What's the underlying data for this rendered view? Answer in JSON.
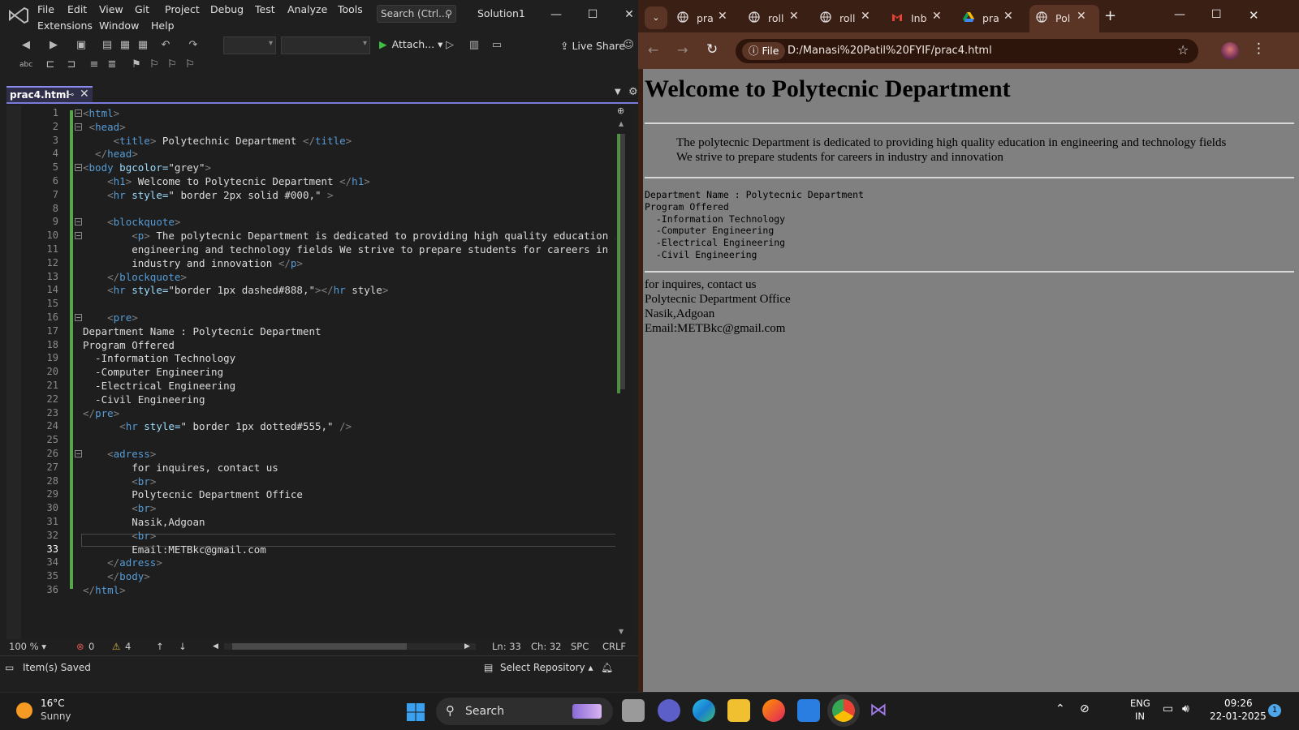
{
  "vs": {
    "menu": [
      "File",
      "Edit",
      "View",
      "Git",
      "Project",
      "Debug",
      "Test",
      "Analyze",
      "Tools",
      "Extensions",
      "Window",
      "Help"
    ],
    "search_placeholder": "Search (Ctrl...",
    "solution": "Solution1",
    "attach_label": "Attach...",
    "liveshare_label": "Live Share",
    "tab_label": "prac4.html",
    "code_lines": [
      "<html>",
      " <head>",
      "     <title> Polytechnic Department </title>",
      "  </head>",
      "<body bgcolor=\"grey\">",
      "    <h1> Welcome to Polytecnic Department </h1>",
      "    <hr style=\" border 2px solid #000,\" >",
      "",
      "    <blockquote>",
      "        <p> The polytecnic Department is dedicated to providing high quality education i",
      "        engineering and technology fields We strive to prepare students for careers in",
      "        industry and innovation </p>",
      "    </blockquote>",
      "    <hr style=\"border 1px dashed#888,\"></hr style>",
      "",
      "    <pre>",
      "Department Name : Polytecnic Department",
      "Program Offered",
      "  -Information Technology",
      "  -Computer Engineering",
      "  -Electrical Engineering",
      "  -Civil Engineering",
      "</pre>",
      "      <hr style=\" border 1px dotted#555,\" />",
      "",
      "    <adress>",
      "        for inquires, contact us",
      "        <br>",
      "        Polytecnic Department Office",
      "        <br>",
      "        Nasik,Adgoan",
      "        <br>",
      "        Email:METBkc@gmail.com",
      "    </adress>",
      "    </body>",
      "</html>"
    ],
    "current_line": 33,
    "zoom": "100 %",
    "errors": "0",
    "warnings": "4",
    "ln": "Ln: 33",
    "ch": "Ch: 32",
    "spc": "SPC",
    "crlf": "CRLF",
    "status_saved": "Item(s) Saved",
    "select_repo": "Select Repository"
  },
  "chrome": {
    "tabs": [
      {
        "label": "pra",
        "icon": "globe-icon"
      },
      {
        "label": "roll",
        "icon": "globe-icon"
      },
      {
        "label": "roll",
        "icon": "globe-icon"
      },
      {
        "label": "Inb",
        "icon": "gmail-icon"
      },
      {
        "label": "pra",
        "icon": "drive-icon"
      },
      {
        "label": "Pol",
        "icon": "globe-icon"
      }
    ],
    "omnibox_file": "File",
    "url": "D:/Manasi%20Patil%20FYIF/prac4.html"
  },
  "page": {
    "h1": "Welcome to Polytecnic Department",
    "blockquote": "The polytecnic Department is dedicated to providing high quality education in engineering and technology fields We strive to prepare students for careers in industry and innovation",
    "pre": "Department Name : Polytecnic Department\nProgram Offered\n  -Information Technology\n  -Computer Engineering\n  -Electrical Engineering\n  -Civil Engineering",
    "address": [
      "for inquires, contact us",
      "Polytecnic Department Office",
      "Nasik,Adgoan",
      "Email:METBkc@gmail.com"
    ]
  },
  "taskbar": {
    "temp": "16°C",
    "weather": "Sunny",
    "search": "Search",
    "lang1": "ENG",
    "lang2": "IN",
    "time": "09:26",
    "date": "22-01-2025",
    "notif_count": "1"
  },
  "colors": {
    "page_bg": "#808080",
    "chrome_frame": "#3a1f15",
    "vs_accent": "#8c8cf0",
    "change_bar": "#57a64a"
  }
}
